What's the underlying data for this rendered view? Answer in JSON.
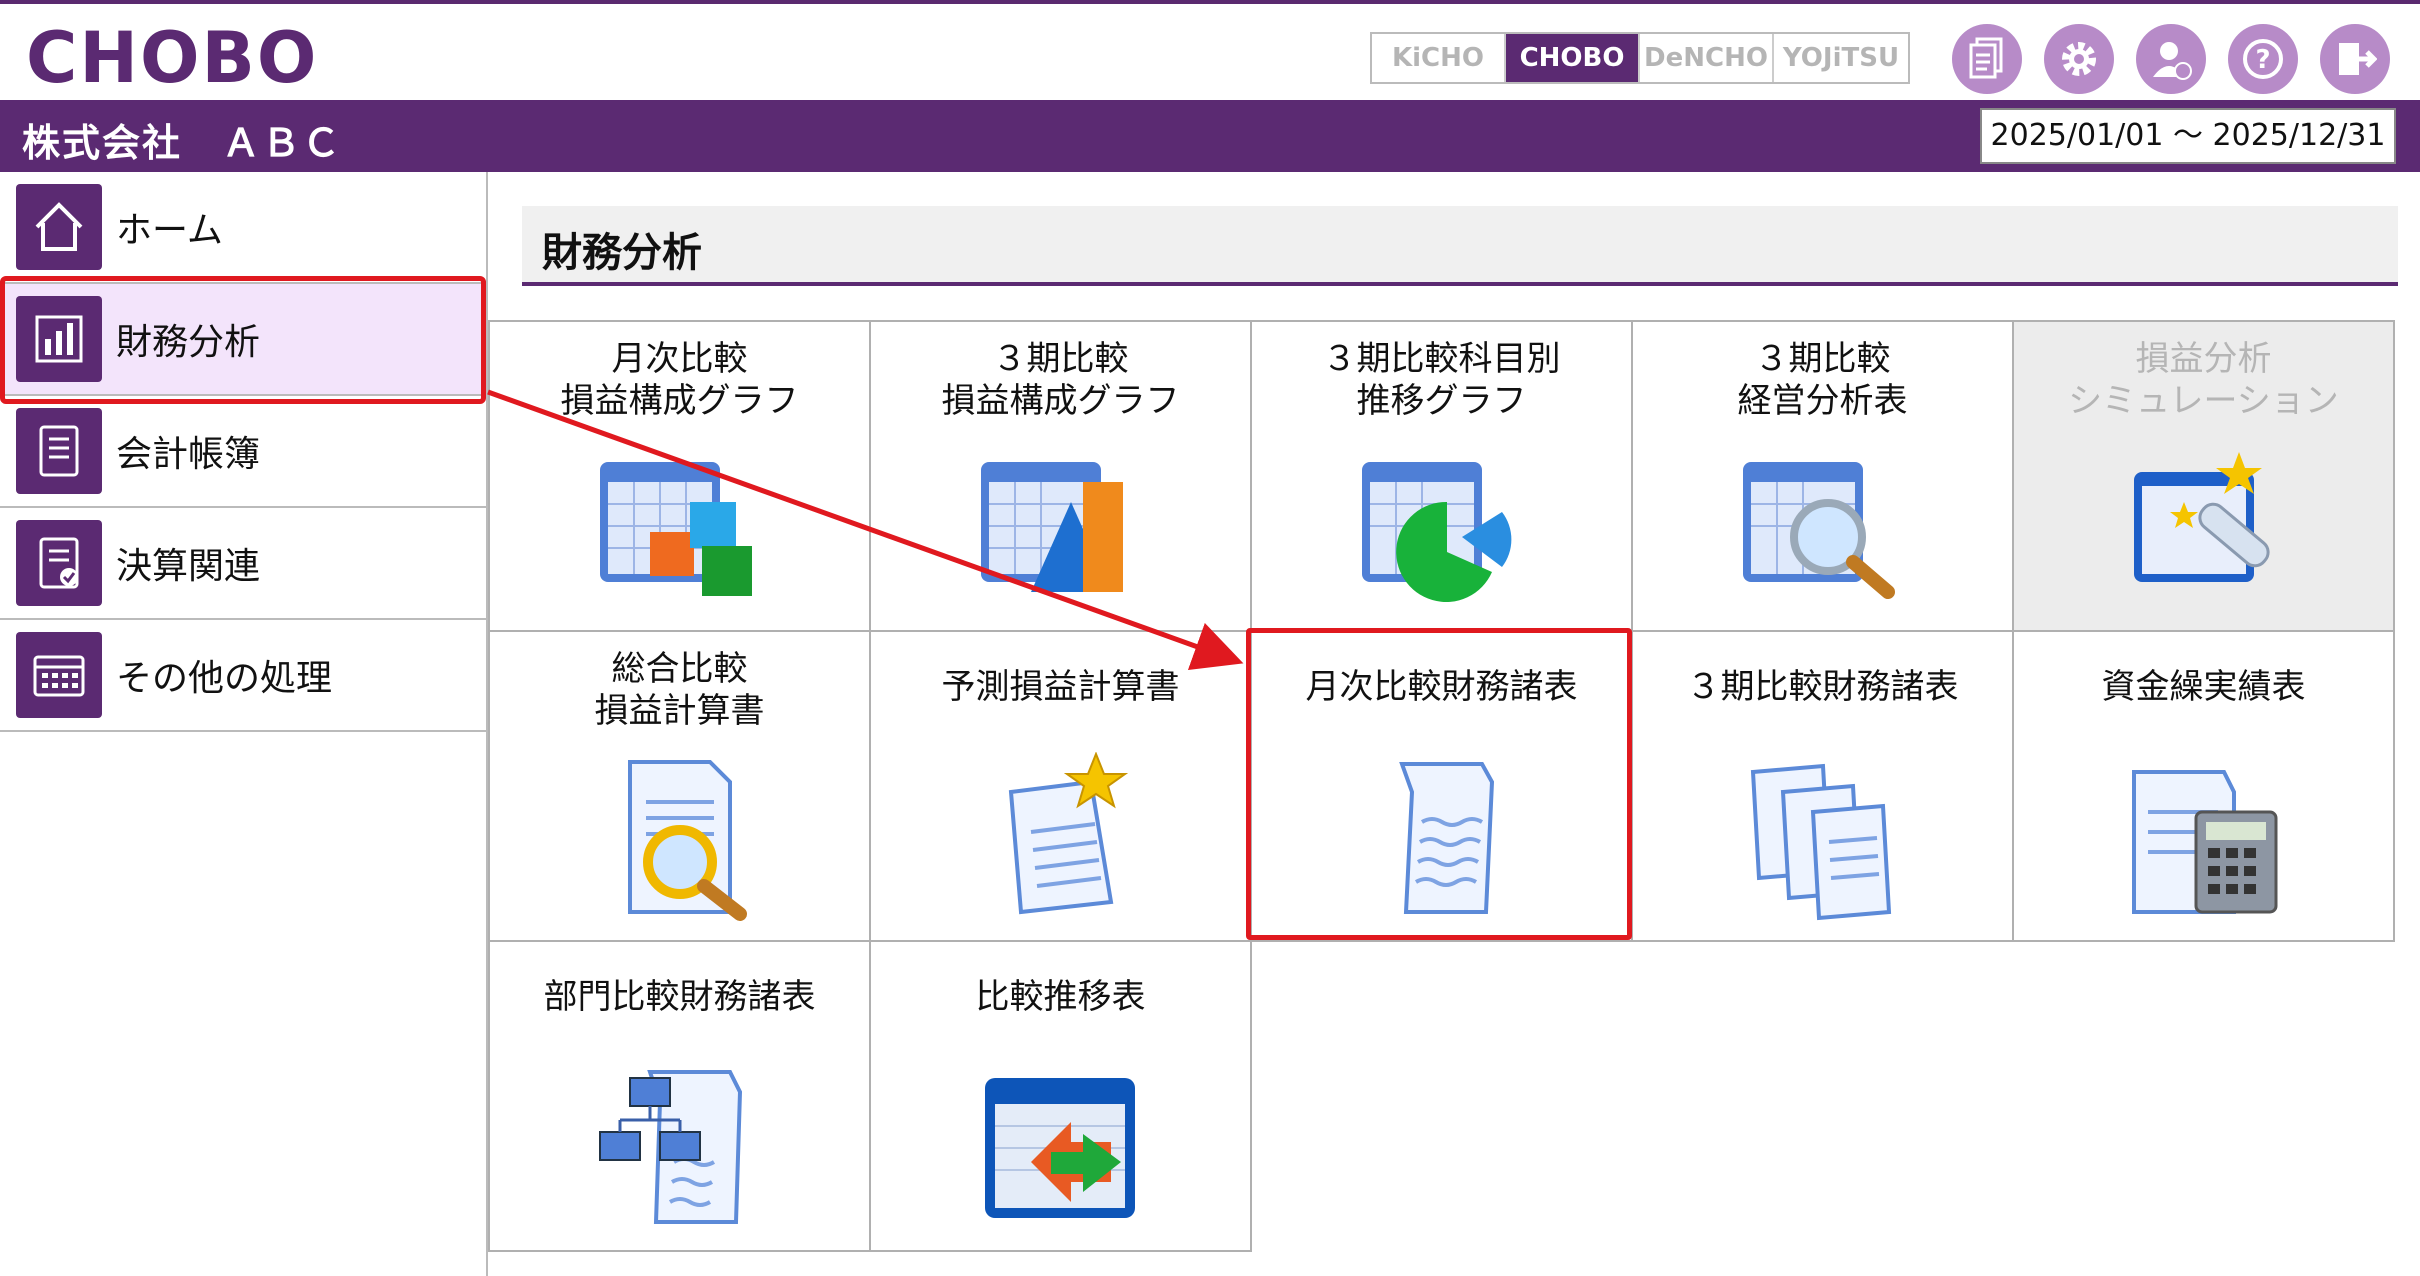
{
  "header": {
    "logo_text": "CHOBO",
    "product_tabs": [
      {
        "label": "KiCHO",
        "active": false
      },
      {
        "label": "CHOBO",
        "active": true
      },
      {
        "label": "DeNCHO",
        "active": false
      },
      {
        "label": "YOJiTSU",
        "active": false
      }
    ],
    "icons": [
      "document-icon",
      "gear-icon",
      "user-icon",
      "help-icon",
      "logout-icon"
    ],
    "accent_color": "#5b2a72"
  },
  "company": {
    "name": "株式会社　ＡＢＣ",
    "period": "2025/01/01 ～ 2025/12/31"
  },
  "sidebar": {
    "items": [
      {
        "label": "ホーム",
        "icon": "home-icon",
        "active": false
      },
      {
        "label": "財務分析",
        "icon": "bar-chart-icon",
        "active": true
      },
      {
        "label": "会計帳簿",
        "icon": "ledger-icon",
        "active": false
      },
      {
        "label": "決算関連",
        "icon": "settlement-icon",
        "active": false
      },
      {
        "label": "その他の処理",
        "icon": "calculator-icon",
        "active": false
      }
    ]
  },
  "main": {
    "title": "財務分析",
    "tiles": [
      {
        "line1": "月次比較",
        "line2": "損益構成グラフ",
        "icon": "calendar-cubes-icon",
        "disabled": false
      },
      {
        "line1": "３期比較",
        "line2": "損益構成グラフ",
        "icon": "calendar-pyramid-icon",
        "disabled": false
      },
      {
        "line1": "３期比較科目別",
        "line2": "推移グラフ",
        "icon": "calendar-pie-icon",
        "disabled": false
      },
      {
        "line1": "３期比較",
        "line2": "経営分析表",
        "icon": "calendar-magnifier-icon",
        "disabled": false
      },
      {
        "line1": "損益分析",
        "line2": "シミュレーション",
        "icon": "telescope-stars-icon",
        "disabled": true
      },
      {
        "line1": "総合比較",
        "line2": "損益計算書",
        "icon": "document-magnifier-icon",
        "disabled": false
      },
      {
        "line1": "予測損益計算書",
        "line2": "",
        "icon": "document-star-icon",
        "disabled": false
      },
      {
        "line1": "月次比較財務諸表",
        "line2": "",
        "icon": "document-icon",
        "disabled": false
      },
      {
        "line1": "３期比較財務諸表",
        "line2": "",
        "icon": "documents-stack-icon",
        "disabled": false
      },
      {
        "line1": "資金繰実績表",
        "line2": "",
        "icon": "document-calculator-icon",
        "disabled": false
      },
      {
        "line1": "部門比較財務諸表",
        "line2": "",
        "icon": "document-network-icon",
        "disabled": false
      },
      {
        "line1": "比較推移表",
        "line2": "",
        "icon": "window-arrows-icon",
        "disabled": false
      }
    ]
  },
  "annotation": {
    "highlight_color": "#e0191f"
  }
}
